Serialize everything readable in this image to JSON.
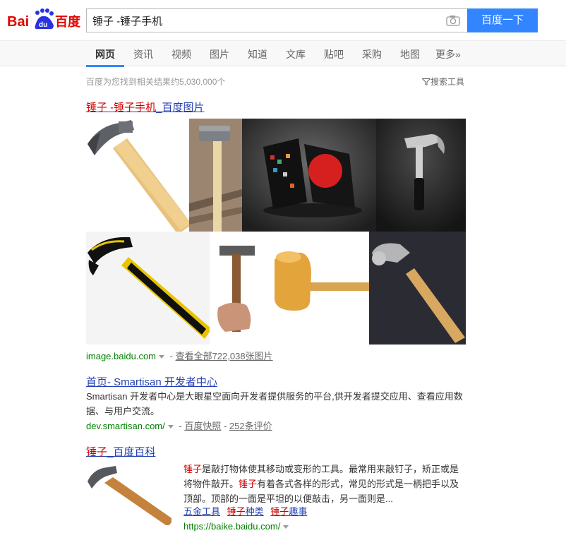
{
  "header": {
    "logo_text": "Bai百度",
    "search_value": "锤子 -锤子手机",
    "search_button": "百度一下"
  },
  "tabs": [
    {
      "label": "网页",
      "active": true
    },
    {
      "label": "资讯"
    },
    {
      "label": "视频"
    },
    {
      "label": "图片"
    },
    {
      "label": "知道"
    },
    {
      "label": "文库"
    },
    {
      "label": "贴吧"
    },
    {
      "label": "采购"
    },
    {
      "label": "地图"
    },
    {
      "label": "更多»"
    }
  ],
  "meta": {
    "result_count": "百度为您找到相关结果约5,030,000个",
    "search_tools": "搜索工具"
  },
  "result1": {
    "title_em": "锤子 -锤子手机",
    "title_rest": "_百度图片",
    "url": "image.baidu.com",
    "more_link": "查看全部722,038张图片"
  },
  "result2": {
    "title": "首页- Smartisan 开发者中心",
    "abstract_line1": "Smartisan 开发者中心是大眼星空面向开发者提供服务的平台,供开发者提交应用、查看应用数",
    "abstract_line2": "据、与用户交流。",
    "url": "dev.smartisan.com/",
    "snapshot": "百度快照",
    "reviews": "252条评价"
  },
  "result3": {
    "title_em": "锤子",
    "title_rest": "_百度百科",
    "abstract_em1": "锤子",
    "abstract_p1": "是敲打物体使其移动或变形的工具。最常用来敲钉子，矫正或是",
    "abstract_p2a": "将物件敲开。",
    "abstract_em2": "锤子",
    "abstract_p2b": "有着各式各样的形式，常见的形式是一柄把手以及",
    "abstract_p3": "顶部。顶部的一面是平坦的以便敲击，另一面则是...",
    "sublink1_plain": "五金工具",
    "sublink2_em": "锤子",
    "sublink2_rest": "种类",
    "sublink3_em": "锤子",
    "sublink3_rest": "趣事",
    "url": "https://baike.baidu.com/"
  },
  "colors": {
    "brand_blue": "#3385ff",
    "link_blue": "#2440b3",
    "highlight_red": "#c00",
    "url_green": "#008000"
  },
  "icons": [
    "camera-icon",
    "funnel-icon",
    "paw-icon"
  ]
}
